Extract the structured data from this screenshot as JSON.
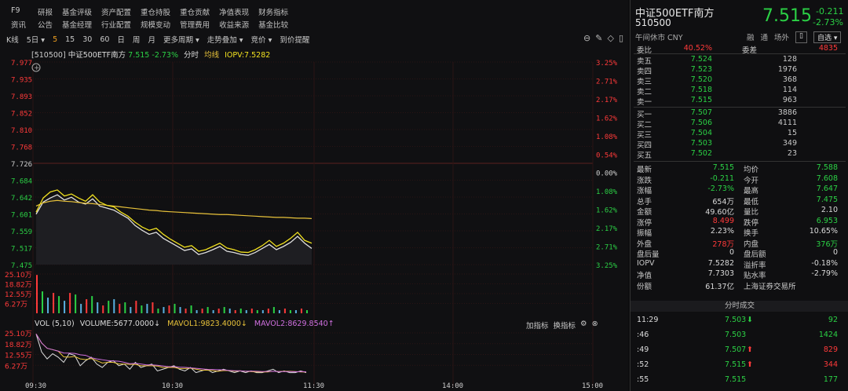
{
  "menu": {
    "tag": "F9",
    "row1": [
      "研报",
      "基金评级",
      "资产配置",
      "重仓持股",
      "重仓贡献",
      "净值表现",
      "财务指标"
    ],
    "row0": "资讯",
    "row2": [
      "公告",
      "基金经理",
      "行业配置",
      "规模变动",
      "管理费用",
      "收益来源",
      "基金比较"
    ]
  },
  "toolbar": {
    "items": [
      "K线",
      "5日",
      "5",
      "15",
      "30",
      "60",
      "日",
      "周",
      "月",
      "更多周期",
      "走势叠加",
      "竞价",
      "到价提醒"
    ],
    "active_index": 2
  },
  "chart_header": {
    "code": "[510500]",
    "name": "中证500ETF南方",
    "price": "7.515",
    "change_pct": "-2.73%",
    "label_fenshi": "分时",
    "label_junxian": "均线",
    "iopv": "IOPV:7.5282"
  },
  "chart_data": {
    "type": "line",
    "x_ticks": [
      "09:30",
      "10:30",
      "11:30",
      "14:00",
      "15:00"
    ],
    "y_left_ticks": [
      "7.977",
      "7.935",
      "7.893",
      "7.852",
      "7.810",
      "7.768",
      "7.726",
      "7.684",
      "7.642",
      "7.601",
      "7.559",
      "7.517",
      "7.475"
    ],
    "y_right_ticks": [
      "3.25%",
      "2.71%",
      "2.17%",
      "1.62%",
      "1.08%",
      "0.54%",
      "0.00%",
      "1.08%",
      "1.62%",
      "2.17%",
      "2.71%",
      "3.25%"
    ],
    "ylim": [
      7.475,
      7.977
    ],
    "series": [
      {
        "name": "分时",
        "color": "#e0e0e0",
        "values": [
          7.6,
          7.63,
          7.64,
          7.648,
          7.635,
          7.642,
          7.63,
          7.625,
          7.638,
          7.62,
          7.615,
          7.61,
          7.6,
          7.59,
          7.572,
          7.56,
          7.55,
          7.555,
          7.54,
          7.53,
          7.52,
          7.51,
          7.514,
          7.5,
          7.505,
          7.512,
          7.52,
          7.508,
          7.505,
          7.5,
          7.498,
          7.505,
          7.515,
          7.525,
          7.512,
          7.52,
          7.53,
          7.545,
          7.528,
          7.515
        ]
      },
      {
        "name": "均线",
        "color": "#e8c23a",
        "values": [
          7.62,
          7.628,
          7.632,
          7.634,
          7.632,
          7.631,
          7.629,
          7.627,
          7.626,
          7.624,
          7.622,
          7.62,
          7.618,
          7.616,
          7.614,
          7.612,
          7.61,
          7.609,
          7.607,
          7.606,
          7.605,
          7.604,
          7.603,
          7.602,
          7.601,
          7.6,
          7.599,
          7.599,
          7.598,
          7.597,
          7.596,
          7.595,
          7.594,
          7.593,
          7.592,
          7.592,
          7.591,
          7.59,
          7.59,
          7.589
        ]
      },
      {
        "name": "IOPV",
        "color": "#f0e020",
        "values": [
          7.605,
          7.64,
          7.655,
          7.66,
          7.645,
          7.65,
          7.64,
          7.632,
          7.648,
          7.63,
          7.622,
          7.618,
          7.605,
          7.595,
          7.58,
          7.568,
          7.56,
          7.565,
          7.55,
          7.538,
          7.528,
          7.518,
          7.522,
          7.508,
          7.512,
          7.52,
          7.528,
          7.516,
          7.512,
          7.506,
          7.505,
          7.512,
          7.522,
          7.535,
          7.52,
          7.528,
          7.54,
          7.555,
          7.535,
          7.528
        ]
      }
    ]
  },
  "volume_panel": {
    "y_ticks": [
      "25.10万",
      "18.82万",
      "12.55万",
      "6.27万"
    ],
    "bars": [
      24.5,
      14,
      10,
      13,
      11,
      8,
      13,
      12,
      6,
      9,
      11,
      7,
      5,
      8,
      9,
      6,
      7,
      4,
      8,
      5,
      6,
      7,
      3,
      4,
      5,
      6,
      4,
      3,
      5,
      2,
      3,
      4,
      2,
      3,
      4,
      3,
      2,
      3,
      2,
      3,
      2,
      2,
      3,
      4,
      2,
      3,
      2,
      2,
      3,
      2
    ]
  },
  "indicator_panel": {
    "header": "VOL (5,10)",
    "volume": "VOLUME:5677.0000",
    "mavol1": "MAVOL1:9823.4000",
    "mavol2": "MAVOL2:8629.8540",
    "btn_add": "加指标",
    "btn_switch": "换指标",
    "y_ticks": [
      "25.10万",
      "18.82万",
      "12.55万",
      "6.27万"
    ]
  },
  "quote": {
    "name": "中证500ETF南方",
    "code": "510500",
    "price": "7.515",
    "change": "-0.211",
    "change_pct": "-2.73%",
    "status": "午间休市 CNY",
    "rong": "融",
    "tong": "通",
    "changwai": "场外",
    "zixuan": "自选"
  },
  "orderbook": {
    "weibi_label": "委比",
    "weibi_val": "40.52%",
    "weicha_label": "委差",
    "weicha_val": "4835",
    "asks": [
      {
        "label": "卖五",
        "price": "7.524",
        "vol": "128"
      },
      {
        "label": "卖四",
        "price": "7.523",
        "vol": "1976"
      },
      {
        "label": "卖三",
        "price": "7.520",
        "vol": "368"
      },
      {
        "label": "卖二",
        "price": "7.518",
        "vol": "114"
      },
      {
        "label": "卖一",
        "price": "7.515",
        "vol": "963"
      }
    ],
    "bids": [
      {
        "label": "买一",
        "price": "7.507",
        "vol": "3886"
      },
      {
        "label": "买二",
        "price": "7.506",
        "vol": "4111"
      },
      {
        "label": "买三",
        "price": "7.504",
        "vol": "15"
      },
      {
        "label": "买四",
        "price": "7.503",
        "vol": "349"
      },
      {
        "label": "买五",
        "price": "7.502",
        "vol": "23"
      }
    ]
  },
  "stats": [
    {
      "l1": "最新",
      "v1": "7.515",
      "c1": "green",
      "l2": "均价",
      "v2": "7.588",
      "c2": "green"
    },
    {
      "l1": "涨跌",
      "v1": "-0.211",
      "c1": "green",
      "l2": "今开",
      "v2": "7.608",
      "c2": "green"
    },
    {
      "l1": "涨幅",
      "v1": "-2.73%",
      "c1": "green",
      "l2": "最高",
      "v2": "7.647",
      "c2": "green"
    },
    {
      "l1": "总手",
      "v1": "654万",
      "c1": "white",
      "l2": "最低",
      "v2": "7.475",
      "c2": "green"
    },
    {
      "l1": "金额",
      "v1": "49.60亿",
      "c1": "white",
      "l2": "量比",
      "v2": "2.10",
      "c2": "white"
    },
    {
      "l1": "涨停",
      "v1": "8.499",
      "c1": "red",
      "l2": "跌停",
      "v2": "6.953",
      "c2": "green"
    },
    {
      "l1": "振幅",
      "v1": "2.23%",
      "c1": "white",
      "l2": "换手",
      "v2": "10.65%",
      "c2": "white"
    },
    {
      "l1": "外盘",
      "v1": "278万",
      "c1": "red",
      "l2": "内盘",
      "v2": "376万",
      "c2": "green"
    },
    {
      "l1": "盘后量",
      "v1": "0",
      "c1": "white",
      "l2": "盘后额",
      "v2": "0",
      "c2": "white"
    },
    {
      "l1": "IOPV",
      "v1": "7.5282",
      "c1": "white",
      "l2": "溢折率",
      "v2": "-0.18%",
      "c2": "white"
    },
    {
      "l1": "净值",
      "v1": "7.7303",
      "c1": "white",
      "l2": "贴水率",
      "v2": "-2.79%",
      "c2": "white"
    },
    {
      "l1": "份额",
      "v1": "61.37亿",
      "c1": "white",
      "l2": "上海证券交易所",
      "v2": "",
      "c2": "white"
    }
  ],
  "trades_header": "分时成交",
  "trades": [
    {
      "time": "11:29",
      "price": "7.503",
      "arrow": "down",
      "vol": "92"
    },
    {
      "time": ":46",
      "price": "7.503",
      "arrow": "",
      "vol": "1424"
    },
    {
      "time": ":49",
      "price": "7.507",
      "arrow": "up",
      "vol": "829"
    },
    {
      "time": ":52",
      "price": "7.515",
      "arrow": "up",
      "vol": "344"
    },
    {
      "time": ":55",
      "price": "7.515",
      "arrow": "",
      "vol": "177"
    }
  ]
}
